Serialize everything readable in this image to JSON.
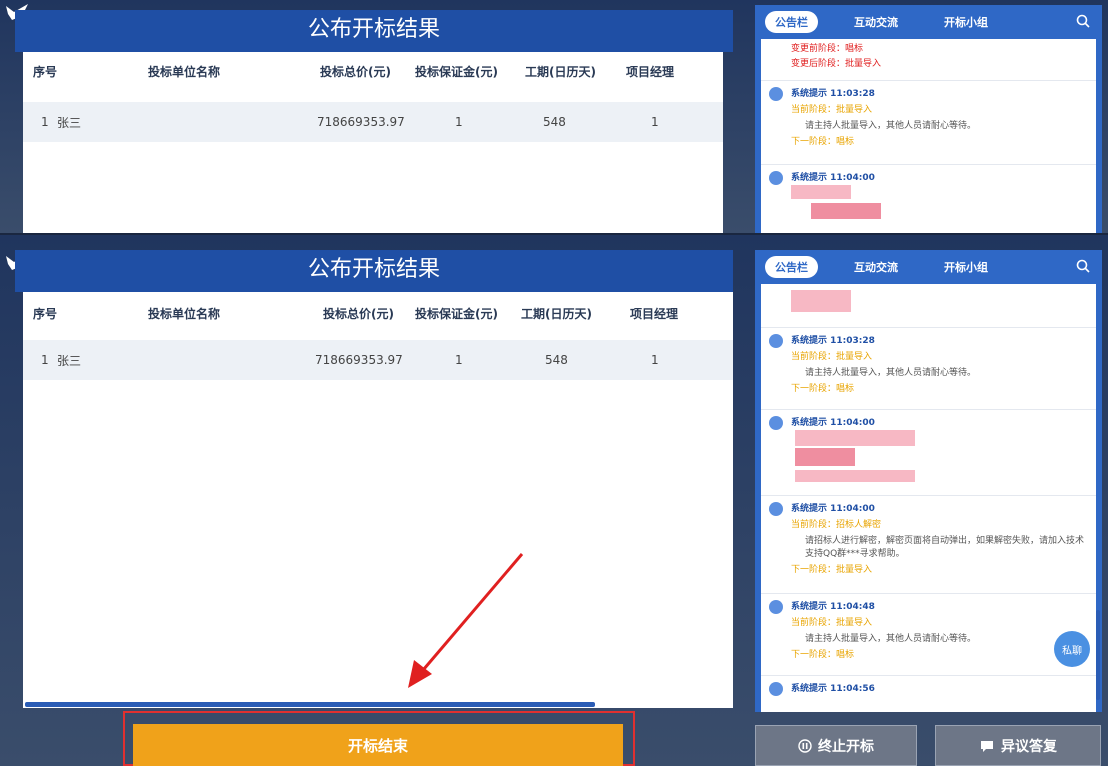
{
  "colors": {
    "title_bar": "#1f4fa5",
    "accent_orange": "#f0a21a",
    "chat_blue": "#2f68c6",
    "alert_red": "#e02020"
  },
  "top": {
    "title": "公布开标结果",
    "headers": [
      "序号",
      "投标单位名称",
      "投标总价(元)",
      "投标保证金(元)",
      "工期(日历天)",
      "项目经理"
    ],
    "row": {
      "index": "1",
      "name": "张三",
      "price": "718669353.97",
      "deposit": "1",
      "days": "548",
      "manager": "1"
    }
  },
  "bottom": {
    "title": "公布开标结果",
    "headers": [
      "序号",
      "投标单位名称",
      "投标总价(元)",
      "投标保证金(元)",
      "工期(日历天)",
      "项目经理"
    ],
    "row": {
      "index": "1",
      "name": "张三",
      "price": "718669353.97",
      "deposit": "1",
      "days": "548",
      "manager": "1"
    },
    "finish_button": "开标结束",
    "stop_button": "终止开标",
    "objection_button": "异议答复"
  },
  "chat": {
    "tabs": [
      "公告栏",
      "互动交流",
      "开标小组"
    ],
    "fab_label": "私聊",
    "top_msgs": [
      {
        "red1": "变更前阶段：唱标",
        "red2": "变更后阶段：批量导入"
      },
      {
        "header": "系统提示 11:03:28",
        "current": "当前阶段：批量导入",
        "body": "请主持人批量导入，其他人员请耐心等待。",
        "next": "下一阶段：唱标"
      },
      {
        "header": "系统提示 11:04:00"
      }
    ],
    "bottom_msgs": [
      {
        "header": "系统提示 11:03:28",
        "current": "当前阶段：批量导入",
        "body": "请主持人批量导入，其他人员请耐心等待。",
        "next": "下一阶段：唱标"
      },
      {
        "header": "系统提示 11:04:00"
      },
      {
        "header": "系统提示 11:04:00",
        "current": "当前阶段：招标人解密",
        "body": "请招标人进行解密，解密页面将自动弹出，如果解密失败，请加入技术支持QQ群***寻求帮助。",
        "next": "下一阶段：批量导入"
      },
      {
        "header": "系统提示 11:04:48",
        "current": "当前阶段：批量导入",
        "body": "请主持人批量导入，其他人员请耐心等待。",
        "next": "下一阶段：唱标"
      },
      {
        "header": "系统提示 11:04:56"
      }
    ]
  }
}
